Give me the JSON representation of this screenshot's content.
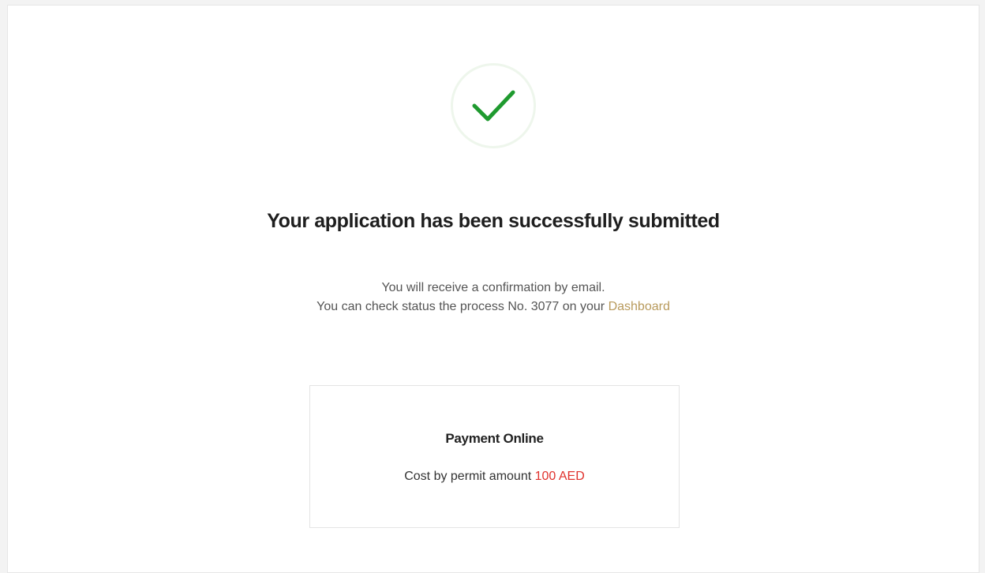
{
  "success": {
    "icon": "checkmark-icon",
    "title": "Your application has been successfully submitted",
    "line1": "You will receive a confirmation by email.",
    "line2_prefix": "You can check status the process No. 3077 on your ",
    "dashboard_link": "Dashboard"
  },
  "payment": {
    "title": "Payment Online",
    "cost_label": "Cost by permit amount ",
    "amount": "100 AED"
  },
  "colors": {
    "check_green": "#1f9a2f",
    "link_gold": "#b89a5c",
    "amount_red": "#e0322d"
  }
}
